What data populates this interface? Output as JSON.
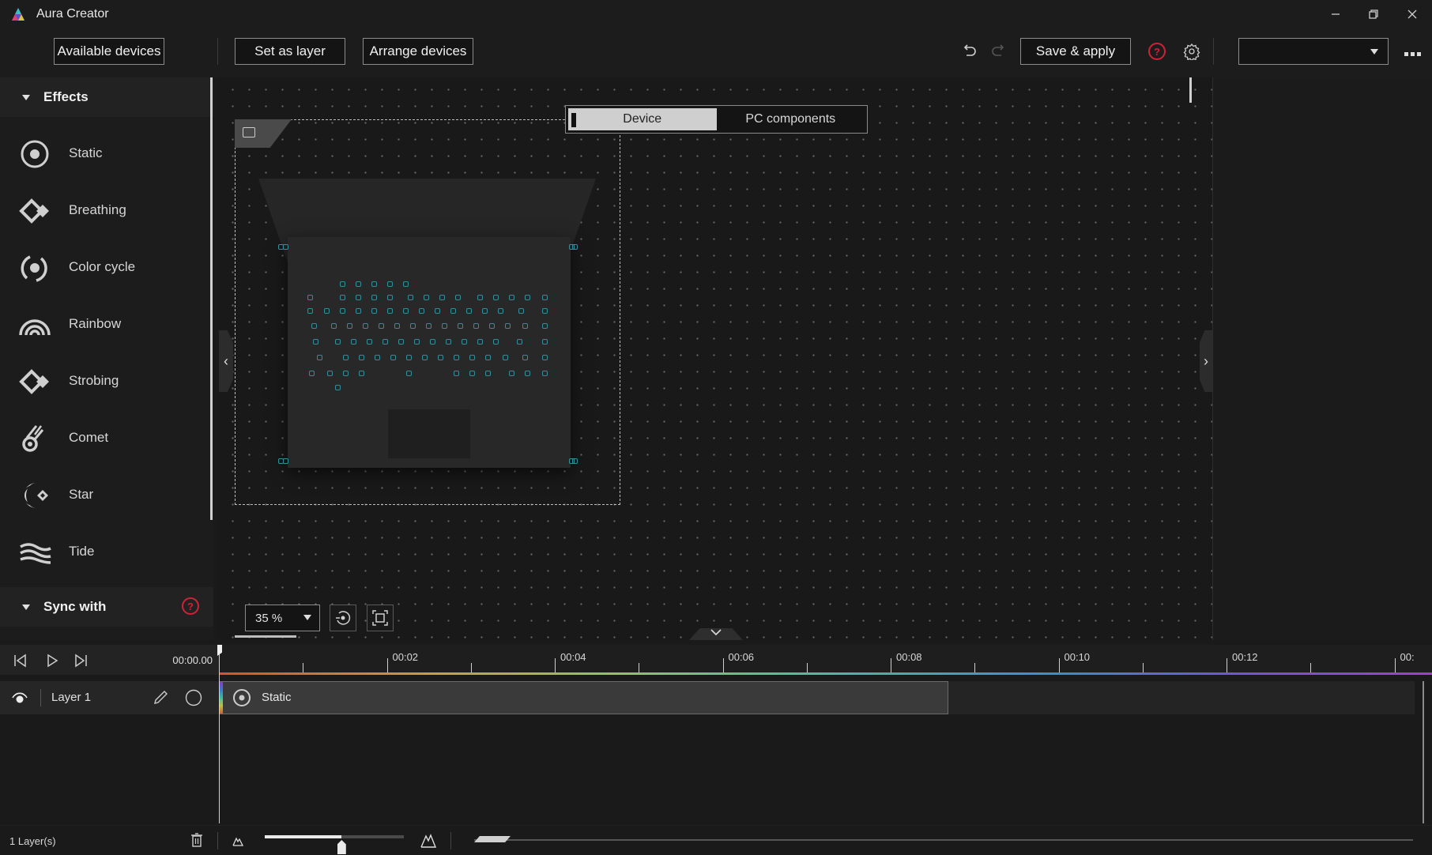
{
  "app": {
    "title": "Aura Creator"
  },
  "window_controls": {
    "minimize": "minimize-icon",
    "restore": "restore-icon",
    "close": "close-icon"
  },
  "toolbar": {
    "available_devices": "Available devices",
    "set_as_layer": "Set as layer",
    "arrange_devices": "Arrange devices",
    "save_apply": "Save & apply",
    "help": "?",
    "profile_dropdown_value": ""
  },
  "sidebar": {
    "effects_header": "Effects",
    "effects": [
      {
        "label": "Static",
        "icon": "static-icon"
      },
      {
        "label": "Breathing",
        "icon": "breathing-icon"
      },
      {
        "label": "Color cycle",
        "icon": "color-cycle-icon"
      },
      {
        "label": "Rainbow",
        "icon": "rainbow-icon"
      },
      {
        "label": "Strobing",
        "icon": "strobing-icon"
      },
      {
        "label": "Comet",
        "icon": "comet-icon"
      },
      {
        "label": "Star",
        "icon": "star-icon"
      },
      {
        "label": "Tide",
        "icon": "tide-icon"
      }
    ],
    "sync_header": "Sync with",
    "sync_help": "?"
  },
  "canvas": {
    "tabs": [
      {
        "label": "Device",
        "active": true
      },
      {
        "label": "PC components",
        "active": false
      }
    ],
    "zoom_value": "35 %",
    "led_color": "#2f8f9a"
  },
  "timeline": {
    "current_time": "00:00.00",
    "ticks": [
      "00:02",
      "00:04",
      "00:06",
      "00:08",
      "00:10",
      "00:12",
      "00:"
    ],
    "layers": [
      {
        "name": "Layer 1",
        "clip_label": "Static"
      }
    ]
  },
  "statusbar": {
    "layer_count": "1 Layer(s)",
    "zoom_slider_value": 0.55
  }
}
